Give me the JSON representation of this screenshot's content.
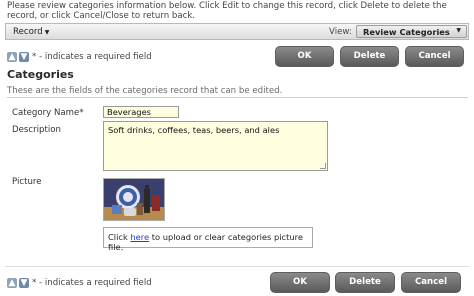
{
  "instructions": "Please review categories information below. Click Edit to change this record, click Delete to delete the record, or click Cancel/Close to return back.",
  "record_bar": {
    "record_menu_label": "Record",
    "view_label": "View:",
    "view_value": "Review Categories"
  },
  "required_note": "* - indicates a required field",
  "buttons": {
    "ok": "OK",
    "delete": "Delete",
    "cancel": "Cancel"
  },
  "section": {
    "title": "Categories",
    "description": "These are the fields of the categories record that can be edited."
  },
  "fields": {
    "category_name": {
      "label": "Category Name",
      "required_marker": "*",
      "value": "Beverages"
    },
    "description": {
      "label": "Description",
      "value": "Soft drinks, coffees, teas, beers, and ales"
    },
    "picture": {
      "label": "Picture",
      "upload_prefix": "Click ",
      "upload_link": "here",
      "upload_suffix": " to upload or clear categories picture file."
    }
  },
  "icons": {
    "up": "up-arrow-icon",
    "down": "down-arrow-icon",
    "record_caret": "chevron-down-icon",
    "view_caret": "chevron-down-icon"
  }
}
